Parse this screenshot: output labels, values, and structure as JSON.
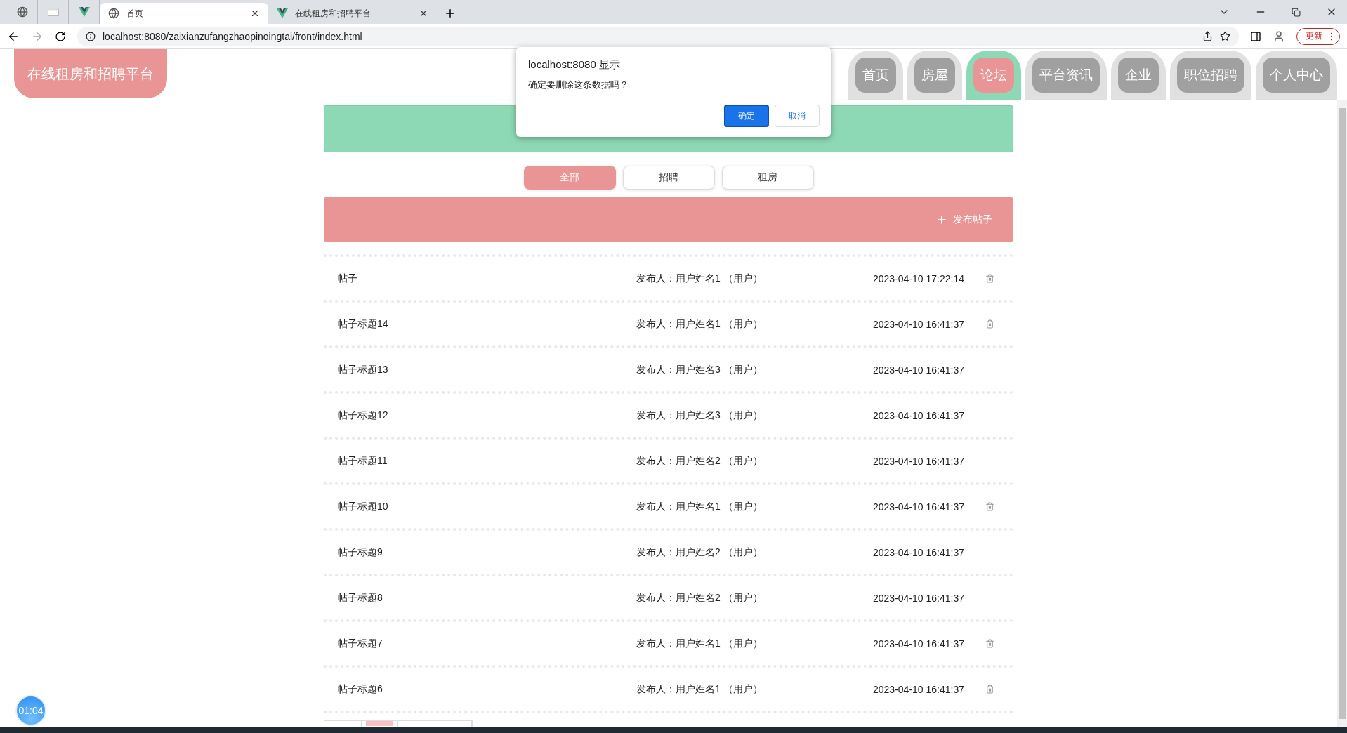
{
  "browser": {
    "pinned_tabs": [
      {
        "kind": "globe"
      },
      {
        "kind": "page"
      },
      {
        "kind": "vue"
      }
    ],
    "tabs": [
      {
        "title": "首页",
        "kind": "globe",
        "selected": true
      },
      {
        "title": "在线租房和招聘平台",
        "kind": "vue",
        "selected": false
      }
    ],
    "url": "localhost:8080/zaixianzufangzhaopinoingtai/front/index.html",
    "update_button": "更新"
  },
  "site": {
    "logo": "在线租房和招聘平台",
    "nav": [
      {
        "label": "首页",
        "selected": false
      },
      {
        "label": "房屋",
        "selected": false
      },
      {
        "label": "论坛",
        "selected": true
      },
      {
        "label": "平台资讯",
        "selected": false
      },
      {
        "label": "企业",
        "selected": false
      },
      {
        "label": "职位招聘",
        "selected": false
      },
      {
        "label": "个人中心",
        "selected": false
      }
    ]
  },
  "filters": [
    {
      "label": "全部",
      "selected": true
    },
    {
      "label": "招聘",
      "selected": false
    },
    {
      "label": "租房",
      "selected": false
    }
  ],
  "post_button": "发布帖子",
  "posts": [
    {
      "title": "帖子",
      "author": "发布人：用户姓名1 （用户）",
      "time": "2023-04-10 17:22:14",
      "deletable": true
    },
    {
      "title": "帖子标题14",
      "author": "发布人：用户姓名1 （用户）",
      "time": "2023-04-10 16:41:37",
      "deletable": true
    },
    {
      "title": "帖子标题13",
      "author": "发布人：用户姓名3 （用户）",
      "time": "2023-04-10 16:41:37",
      "deletable": false
    },
    {
      "title": "帖子标题12",
      "author": "发布人：用户姓名3 （用户）",
      "time": "2023-04-10 16:41:37",
      "deletable": false
    },
    {
      "title": "帖子标题11",
      "author": "发布人：用户姓名2 （用户）",
      "time": "2023-04-10 16:41:37",
      "deletable": false
    },
    {
      "title": "帖子标题10",
      "author": "发布人：用户姓名1 （用户）",
      "time": "2023-04-10 16:41:37",
      "deletable": true
    },
    {
      "title": "帖子标题9",
      "author": "发布人：用户姓名2 （用户）",
      "time": "2023-04-10 16:41:37",
      "deletable": false
    },
    {
      "title": "帖子标题8",
      "author": "发布人：用户姓名2 （用户）",
      "time": "2023-04-10 16:41:37",
      "deletable": false
    },
    {
      "title": "帖子标题7",
      "author": "发布人：用户姓名1 （用户）",
      "time": "2023-04-10 16:41:37",
      "deletable": true
    },
    {
      "title": "帖子标题6",
      "author": "发布人：用户姓名1 （用户）",
      "time": "2023-04-10 16:41:37",
      "deletable": true
    }
  ],
  "dialog": {
    "title": "localhost:8080 显示",
    "message": "确定要删除这条数据吗？",
    "buttons": [
      {
        "label": "确定",
        "primary": true
      },
      {
        "label": "取消",
        "primary": false
      }
    ]
  },
  "timer": "01:04"
}
